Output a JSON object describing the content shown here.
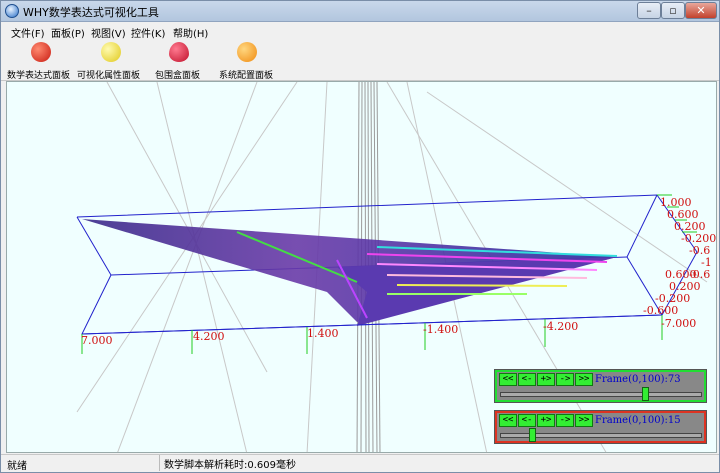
{
  "window": {
    "title": "WHY数学表达式可视化工具",
    "min_label": "–",
    "max_label": "▫",
    "close_label": "✕"
  },
  "menu": [
    {
      "label": "文件(F)"
    },
    {
      "label": "面板(P)"
    },
    {
      "label": "视图(V)"
    },
    {
      "label": "控件(K)"
    },
    {
      "label": "帮助(H)"
    }
  ],
  "toolbar": [
    {
      "label": "数学表达式面板",
      "icon": "tomato-icon",
      "color": "#e53020"
    },
    {
      "label": "可视化属性面板",
      "icon": "lemon-icon",
      "color": "#f2e23a"
    },
    {
      "label": "包围盒面板",
      "icon": "strawberry-icon",
      "color": "#e02040"
    },
    {
      "label": "系统配置面板",
      "icon": "orange-icon",
      "color": "#f7a319"
    }
  ],
  "axis": {
    "x_ticks": [
      "7.000",
      "4.200",
      "1.400",
      "-1.400",
      "-4.200",
      "-7.000"
    ],
    "z_ticks": [
      "1.000",
      "0.600",
      "0.200",
      "-0.200",
      "-0.6",
      "-1",
      "-0.6",
      "0.600",
      "0.200",
      "-0.200",
      "-0.600"
    ]
  },
  "frame_panels": [
    {
      "buttons": [
        "<<",
        "<-",
        "+>",
        "->",
        ">>"
      ],
      "label": "Frame(0,100):73",
      "value": 73,
      "border_color": "#22dd33"
    },
    {
      "buttons": [
        "<<",
        "<-",
        "+>",
        "->",
        ">>"
      ],
      "label": "Frame(0,100):15",
      "value": 15,
      "border_color": "#dd3322"
    }
  ],
  "status": {
    "left": "就绪",
    "middle": "数学脚本解析耗时:0.609毫秒"
  }
}
